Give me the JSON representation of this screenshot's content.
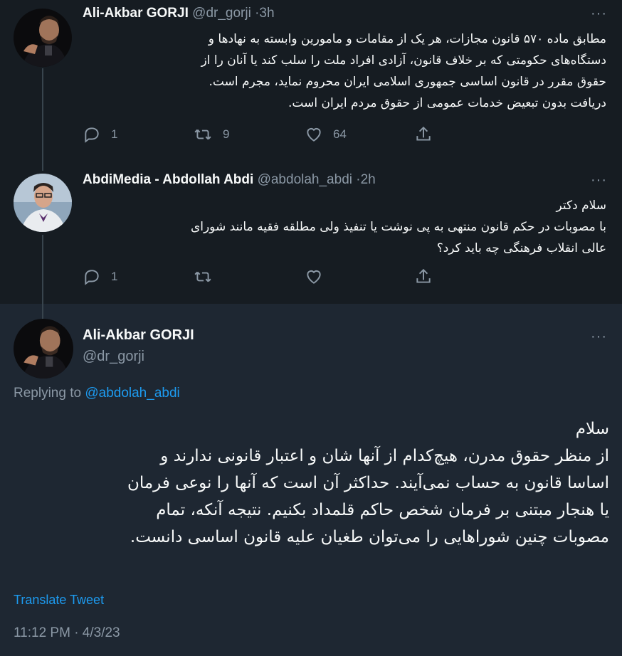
{
  "tweets": [
    {
      "author_name": "Ali-Akbar GORJI",
      "handle": "@dr_gorji",
      "separator": "·",
      "time": "3h",
      "lines": [
        "مطابق ماده ۵۷۰ قانون مجازات، هر یک از مقامات و مامورین وابسته به نهادها و",
        "دستگاه‌های حکومتی که بر خلاف قانون، آزادی افراد ملت را سلب کند یا آنان را از",
        "حقوق مقرر در قانون اساسی جمهوری اسلامی ایران محروم نماید، مجرم است.",
        "دریافت بدون تبعیض خدمات عمومی از حقوق مردم ایران است."
      ],
      "replies": "1",
      "retweets": "9",
      "likes": "64"
    },
    {
      "author_name": "AbdiMedia - Abdollah Abdi",
      "handle": "@abdolah_abdi",
      "separator": "·",
      "time": "2h",
      "lines": [
        "سلام دکتر",
        "با مصوبات در حکم قانون منتهی به پی نوشت یا تنفیذ ولی مطلقه فقیه مانند شورای",
        "عالی انقلاب فرهنگی چه باید کرد؟"
      ],
      "replies": "1",
      "retweets": "",
      "likes": ""
    }
  ],
  "main_tweet": {
    "author_name": "Ali-Akbar GORJI",
    "handle": "@dr_gorji",
    "replying_prefix": "Replying to",
    "replying_to": "@abdolah_abdi",
    "lines": [
      "سلام",
      "از منظر حقوق مدرن، هیچ‌کدام از آنها شان و اعتبار قانونی ندارند و",
      "اساسا قانون به حساب نمی‌آیند. حداکثر آن است که آنها را نوعی فرمان",
      "یا هنجار مبتنی بر فرمان شخص حاکم قلمداد بکنیم. نتیجه آنکه، تمام",
      "مصوبات چنین شوراهایی را می‌توان طغیان علیه قانون اساسی دانست."
    ],
    "translate_label": "Translate Tweet",
    "timestamp": "11:12 PM · 4/3/23"
  },
  "icons": {
    "reply": "reply-icon",
    "retweet": "retweet-icon",
    "like": "like-icon",
    "share": "share-icon",
    "more": "more-icon"
  },
  "colors": {
    "background_top": "#161c22",
    "background_main": "#1e2732",
    "text": "#f7f9f9",
    "muted": "#8b98a5",
    "link": "#1d9bf0"
  }
}
